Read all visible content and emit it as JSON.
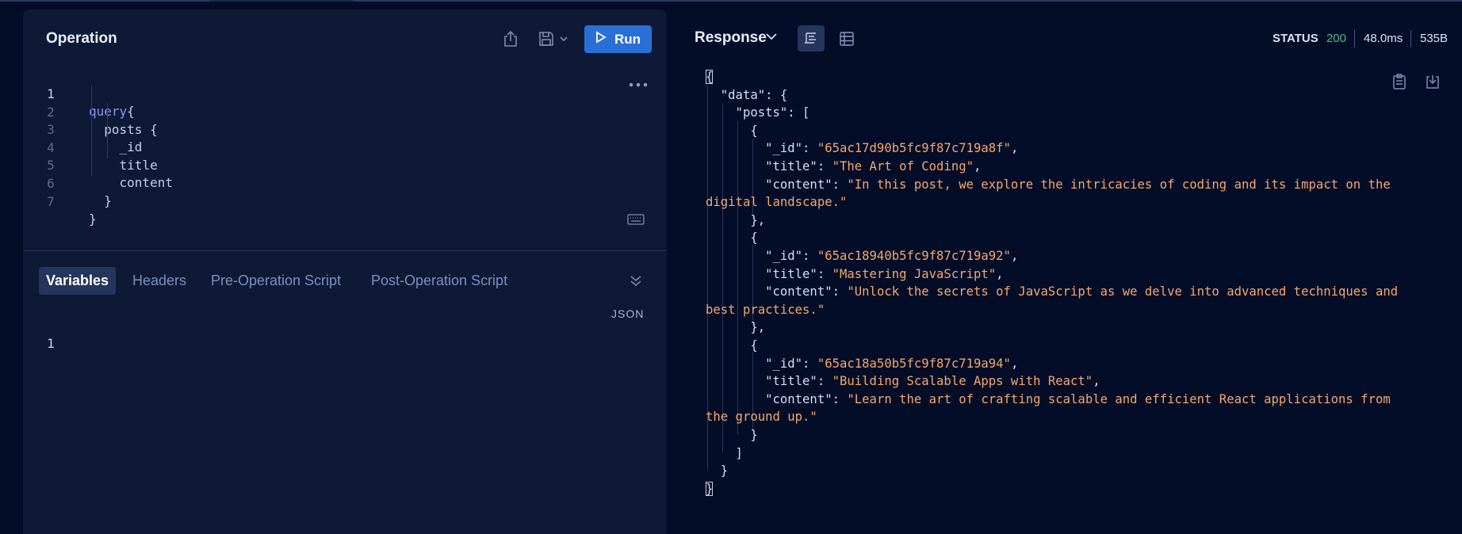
{
  "operation": {
    "title": "Operation",
    "run_label": "Run",
    "lines": [
      {
        "n": "1",
        "code_kw": "query",
        "code": "{"
      },
      {
        "n": "2",
        "code_kw": "",
        "code": "  posts {"
      },
      {
        "n": "3",
        "code_kw": "",
        "code": "    _id"
      },
      {
        "n": "4",
        "code_kw": "",
        "code": "    title"
      },
      {
        "n": "5",
        "code_kw": "",
        "code": "    content"
      },
      {
        "n": "6",
        "code_kw": "",
        "code": "  }"
      },
      {
        "n": "7",
        "code_kw": "",
        "code": "}"
      }
    ]
  },
  "tabs": [
    {
      "label": "Variables"
    },
    {
      "label": "Headers"
    },
    {
      "label": "Pre-Operation Script"
    },
    {
      "label": "Post-Operation Script"
    }
  ],
  "variables": {
    "format_label": "JSON",
    "line_number": "1"
  },
  "response": {
    "title": "Response",
    "status_label": "STATUS",
    "status_code": "200",
    "time": "48.0ms",
    "size": "535B",
    "colors": {
      "string": "#f5a76c",
      "status_ok": "#3fc08a",
      "accent": "#2a6fd6"
    },
    "lines": [
      [
        {
          "t": "{",
          "c": "k"
        }
      ],
      [
        {
          "t": "  \"data\": {",
          "c": "k"
        }
      ],
      [
        {
          "t": "    \"posts\": [",
          "c": "k"
        }
      ],
      [
        {
          "t": "      {",
          "c": "k"
        }
      ],
      [
        {
          "t": "        \"_id\": ",
          "c": "k"
        },
        {
          "t": "\"65ac17d90b5fc9f87c719a8f\"",
          "c": "s"
        },
        {
          "t": ",",
          "c": "k"
        }
      ],
      [
        {
          "t": "        \"title\": ",
          "c": "k"
        },
        {
          "t": "\"The Art of Coding\"",
          "c": "s"
        },
        {
          "t": ",",
          "c": "k"
        }
      ],
      [
        {
          "t": "        \"content\": ",
          "c": "k"
        },
        {
          "t": "\"In this post, we explore the intricacies of coding and its impact on the",
          "c": "s"
        }
      ],
      [
        {
          "t": "digital landscape.\"",
          "c": "s"
        }
      ],
      [
        {
          "t": "      },",
          "c": "k"
        }
      ],
      [
        {
          "t": "      {",
          "c": "k"
        }
      ],
      [
        {
          "t": "        \"_id\": ",
          "c": "k"
        },
        {
          "t": "\"65ac18940b5fc9f87c719a92\"",
          "c": "s"
        },
        {
          "t": ",",
          "c": "k"
        }
      ],
      [
        {
          "t": "        \"title\": ",
          "c": "k"
        },
        {
          "t": "\"Mastering JavaScript\"",
          "c": "s"
        },
        {
          "t": ",",
          "c": "k"
        }
      ],
      [
        {
          "t": "        \"content\": ",
          "c": "k"
        },
        {
          "t": "\"Unlock the secrets of JavaScript as we delve into advanced techniques and",
          "c": "s"
        }
      ],
      [
        {
          "t": "best practices.\"",
          "c": "s"
        }
      ],
      [
        {
          "t": "      },",
          "c": "k"
        }
      ],
      [
        {
          "t": "      {",
          "c": "k"
        }
      ],
      [
        {
          "t": "        \"_id\": ",
          "c": "k"
        },
        {
          "t": "\"65ac18a50b5fc9f87c719a94\"",
          "c": "s"
        },
        {
          "t": ",",
          "c": "k"
        }
      ],
      [
        {
          "t": "        \"title\": ",
          "c": "k"
        },
        {
          "t": "\"Building Scalable Apps with React\"",
          "c": "s"
        },
        {
          "t": ",",
          "c": "k"
        }
      ],
      [
        {
          "t": "        \"content\": ",
          "c": "k"
        },
        {
          "t": "\"Learn the art of crafting scalable and efficient React applications from",
          "c": "s"
        }
      ],
      [
        {
          "t": "the ground up.\"",
          "c": "s"
        }
      ],
      [
        {
          "t": "      }",
          "c": "k"
        }
      ],
      [
        {
          "t": "    ]",
          "c": "k"
        }
      ],
      [
        {
          "t": "  }",
          "c": "k"
        }
      ],
      [
        {
          "t": "}",
          "c": "k"
        }
      ]
    ]
  },
  "icons": {
    "share": "share-icon",
    "save": "save-icon",
    "play": "play-icon",
    "more": "more-horizontal-icon",
    "keyboard": "keyboard-icon",
    "collapse": "chevrons-down-icon",
    "response_dropdown": "chevron-down-icon",
    "text_view": "text-view-icon",
    "table_view": "table-view-icon",
    "copy": "clipboard-icon",
    "download": "download-icon"
  }
}
